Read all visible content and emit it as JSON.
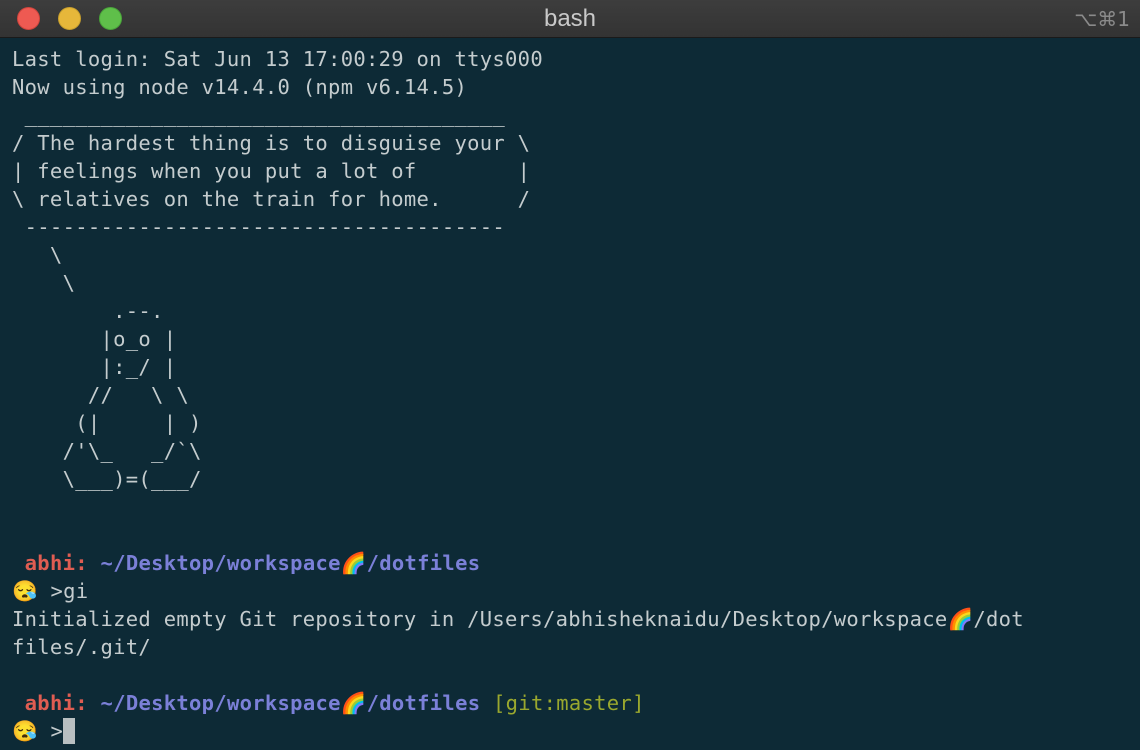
{
  "window": {
    "title": "bash",
    "shortcut": "⌥⌘1"
  },
  "terminal": {
    "login_line": "Last login: Sat Jun 13 17:00:29 on ttys000",
    "node_line": "Now using node v14.4.0 (npm v6.14.5)",
    "cowsay": " ______________________________________\n/ The hardest thing is to disguise your \\\n| feelings when you put a lot of        |\n\\ relatives on the train for home.      /\n --------------------------------------\n   \\\n    \\\n        .--.\n       |o_o |\n       |:_/ |\n      //   \\ \\\n     (|     | )\n    /'\\_   _/`\\\n    \\___)=(___/",
    "prompt1": {
      "user": "abhi",
      "sep": ":",
      "path": "~/Desktop/workspace🌈/dotfiles",
      "emoji": "😪",
      "symbol": ">",
      "command": "gi"
    },
    "output_line1": "Initialized empty Git repository in /Users/abhisheknaidu/Desktop/workspace🌈/dot",
    "output_line2": "files/.git/",
    "prompt2": {
      "user": "abhi",
      "sep": ":",
      "path": "~/Desktop/workspace🌈/dotfiles",
      "git": "[git:master]",
      "emoji": "😪",
      "symbol": ">"
    }
  }
}
